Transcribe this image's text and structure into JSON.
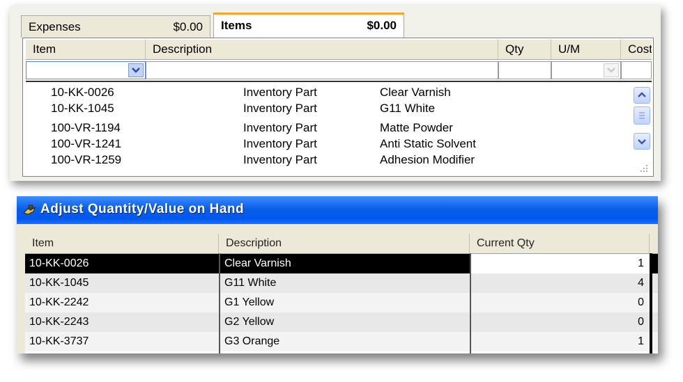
{
  "tabs": {
    "expenses": {
      "label": "Expenses",
      "amount": "$0.00"
    },
    "items": {
      "label": "Items",
      "amount": "$0.00"
    }
  },
  "item_grid": {
    "columns": [
      "Item",
      "Description",
      "Qty",
      "U/M",
      "Cost"
    ],
    "list_rows": [
      {
        "item": "10-KK-0026",
        "type": "Inventory Part",
        "description": "Clear Varnish"
      },
      {
        "item": "10-KK-1045",
        "type": "Inventory Part",
        "description": "G11 White"
      },
      {
        "item": "100-VR-1194",
        "type": "Inventory Part",
        "description": "Matte Powder"
      },
      {
        "item": "100-VR-1241",
        "type": "Inventory Part",
        "description": "Anti Static Solvent"
      },
      {
        "item": "100-VR-1259",
        "type": "Inventory Part",
        "description": "Adhesion Modifier"
      }
    ]
  },
  "adjust_window": {
    "title": "Adjust Quantity/Value on Hand",
    "columns": [
      "Item",
      "Description",
      "Current Qty"
    ],
    "rows": [
      {
        "item": "10-KK-0026",
        "description": "Clear Varnish",
        "qty": "1",
        "selected": true
      },
      {
        "item": "10-KK-1045",
        "description": "G11 White",
        "qty": "4"
      },
      {
        "item": "10-KK-2242",
        "description": "G1 Yellow",
        "qty": "0"
      },
      {
        "item": "10-KK-2243",
        "description": "G2 Yellow",
        "qty": "0"
      },
      {
        "item": "10-KK-3737",
        "description": "G3 Orange",
        "qty": "1"
      }
    ]
  },
  "colors": {
    "tab_accent": "#f0a631",
    "titlebar": "#0a5fe6",
    "selected_row": "#000000"
  },
  "icons": [
    "chevron-down-icon",
    "scroll-up-icon",
    "scroll-thumb-icon",
    "scroll-down-icon",
    "resize-grip-icon",
    "inventory-hand-icon"
  ]
}
